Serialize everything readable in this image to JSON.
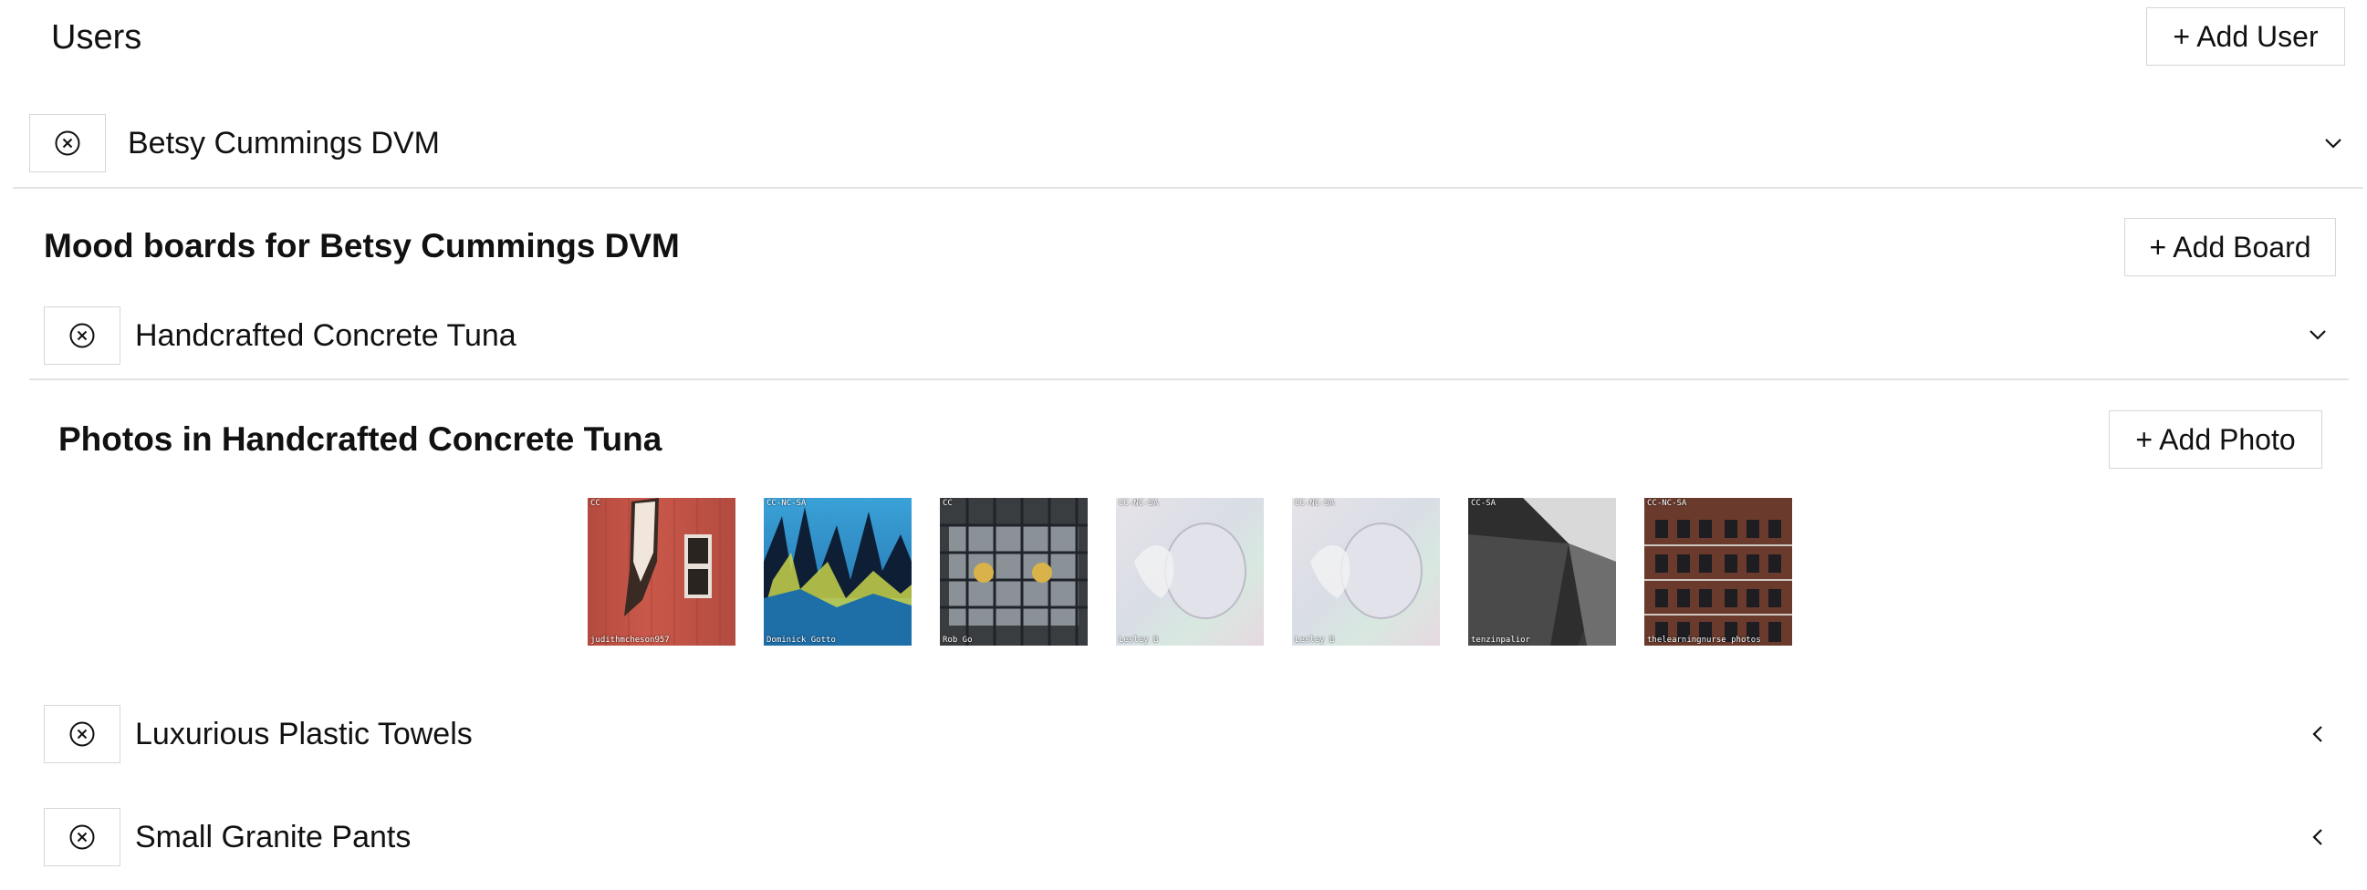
{
  "header": {
    "title": "Users",
    "add_user_label": "+ Add User"
  },
  "user": {
    "name": "Betsy Cummings DVM"
  },
  "boards_section": {
    "title": "Mood boards for Betsy Cummings DVM",
    "add_board_label": "+ Add Board"
  },
  "boards": [
    {
      "name": "Handcrafted Concrete Tuna",
      "expanded": true
    },
    {
      "name": "Luxurious Plastic Towels",
      "expanded": false
    },
    {
      "name": "Small Granite Pants",
      "expanded": false
    }
  ],
  "photos_section": {
    "title": "Photos in Handcrafted Concrete Tuna",
    "add_photo_label": "+ Add Photo"
  },
  "photos": [
    {
      "license": "CC",
      "credit": "judithmcheson957"
    },
    {
      "license": "CC-NC-SA",
      "credit": "Dominick Gotto"
    },
    {
      "license": "CC",
      "credit": "Rob Go"
    },
    {
      "license": "CC-NC-SA",
      "credit": "Lesley B"
    },
    {
      "license": "CC-NC-SA",
      "credit": "Lesley B"
    },
    {
      "license": "CC-SA",
      "credit": "tenzinpalior"
    },
    {
      "license": "CC-NC-SA",
      "credit": "thelearningnurse photos"
    }
  ],
  "icons": {
    "remove": "close-circle-icon",
    "expanded": "chevron-down-icon",
    "collapsed": "chevron-left-icon"
  }
}
